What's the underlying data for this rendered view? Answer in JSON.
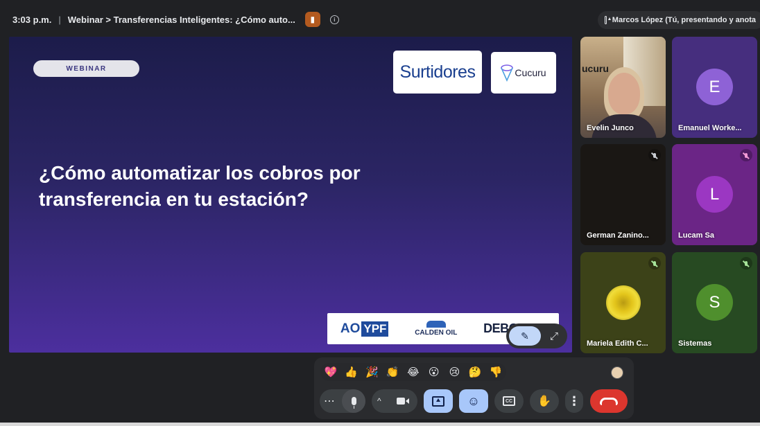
{
  "topbar": {
    "time": "3:03 p.m.",
    "separator": "|",
    "meeting_title": "Webinar > Transferencias Inteligentes: ¿Cómo auto...",
    "presenter_status": "Marcos López (Tú, presentando y anota"
  },
  "slide": {
    "tag": "WEBINAR",
    "logo_left": "Surtidores",
    "logo_right": "Cucuru",
    "title_line1": "¿Cómo automatizar los cobros por",
    "title_line2": "transferencia en tu estación?",
    "sponsors": {
      "ao": "AO",
      "ypf": "YPF",
      "calden": "CALDEN OIL",
      "debo": "DEBO"
    }
  },
  "participants": [
    {
      "name": "Evelin Junco",
      "initial": "",
      "color": "#c9b08a",
      "muted": false
    },
    {
      "name": "Emanuel Worke...",
      "initial": "E",
      "color": "#8e62d6",
      "muted": false
    },
    {
      "name": "German Zanino...",
      "initial": "",
      "color": "#1a1714",
      "muted": true
    },
    {
      "name": "Lucam Sa",
      "initial": "L",
      "color": "#9b37c2",
      "muted": true
    },
    {
      "name": "Mariela Edith C...",
      "initial": "",
      "color": "#3c4218",
      "muted": true
    },
    {
      "name": "Sistemas",
      "initial": "S",
      "color": "#4f8f2d",
      "muted": true
    }
  ],
  "reactions": [
    "💖",
    "👍",
    "🎉",
    "👏",
    "😂",
    "😮",
    "😢",
    "🤔",
    "👎"
  ],
  "controls": {
    "more_dots": "⋯",
    "chevron": "^",
    "raise_hand": "✋",
    "more_vertical": "⋮",
    "emoji": "☺"
  },
  "colors": {
    "end_call": "#dc362e",
    "active_control": "#a8c7fa",
    "slide_gradient_end": "#4c2f9e"
  }
}
